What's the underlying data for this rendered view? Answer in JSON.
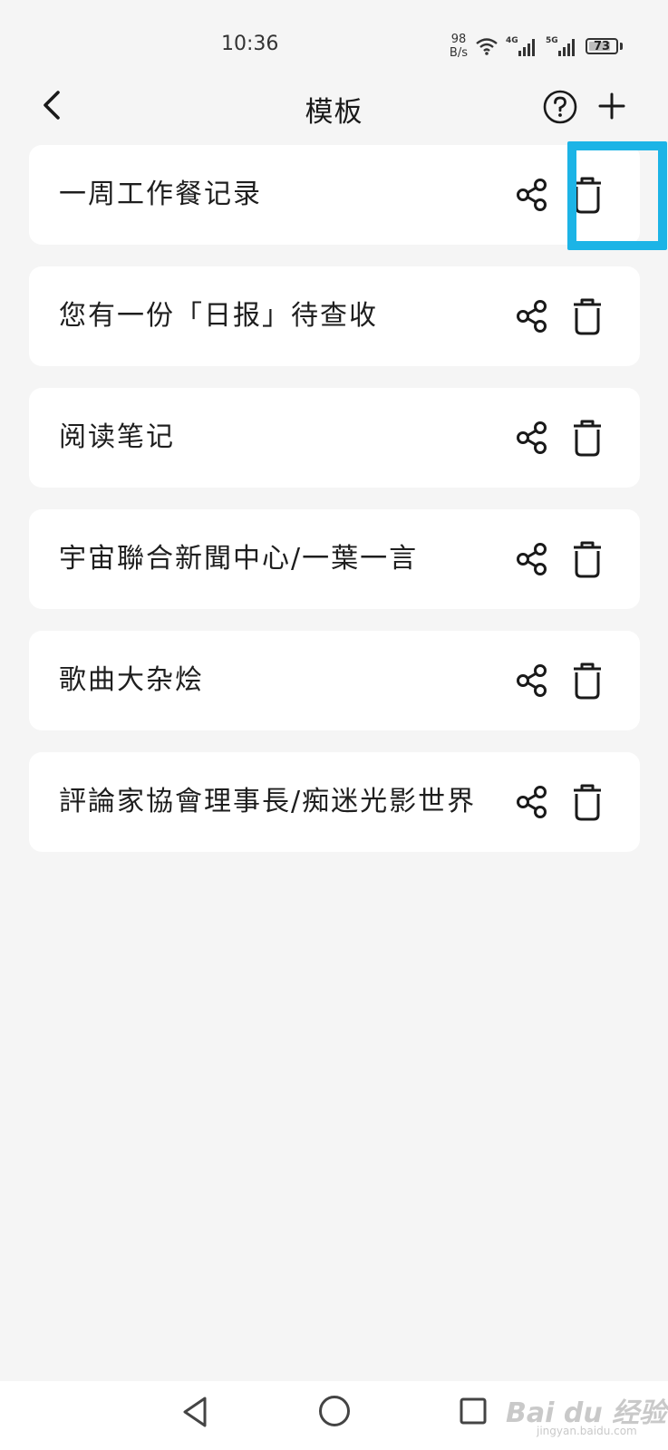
{
  "status_bar": {
    "time": "10:36",
    "net_speed_value": "98",
    "net_speed_unit": "B/s",
    "sim1_label": "4G",
    "sim2_label": "5G",
    "battery_level": "73"
  },
  "header": {
    "title": "模板",
    "back_icon": "chevron-left-icon",
    "help_icon": "question-circle-icon",
    "add_icon": "plus-icon"
  },
  "templates": [
    {
      "title": "一周工作餐记录"
    },
    {
      "title": "您有一份「日报」待查收"
    },
    {
      "title": "阅读笔记"
    },
    {
      "title": "宇宙聯合新聞中心/一葉一言"
    },
    {
      "title": "歌曲大杂烩"
    },
    {
      "title": "評論家協會理事長/痴迷光影世界"
    }
  ],
  "item_icons": {
    "share": "share-icon",
    "delete": "trash-icon"
  },
  "nav_bar": {
    "back_icon": "triangle-back-icon",
    "home_icon": "circle-home-icon",
    "recent_icon": "square-recent-icon"
  },
  "watermark": {
    "text": "Bai du 经验",
    "sub": "jingyan.baidu.com"
  },
  "colors": {
    "background": "#f5f5f5",
    "card": "#ffffff",
    "highlight": "#1cb4e6",
    "text": "#1e1e1e"
  }
}
